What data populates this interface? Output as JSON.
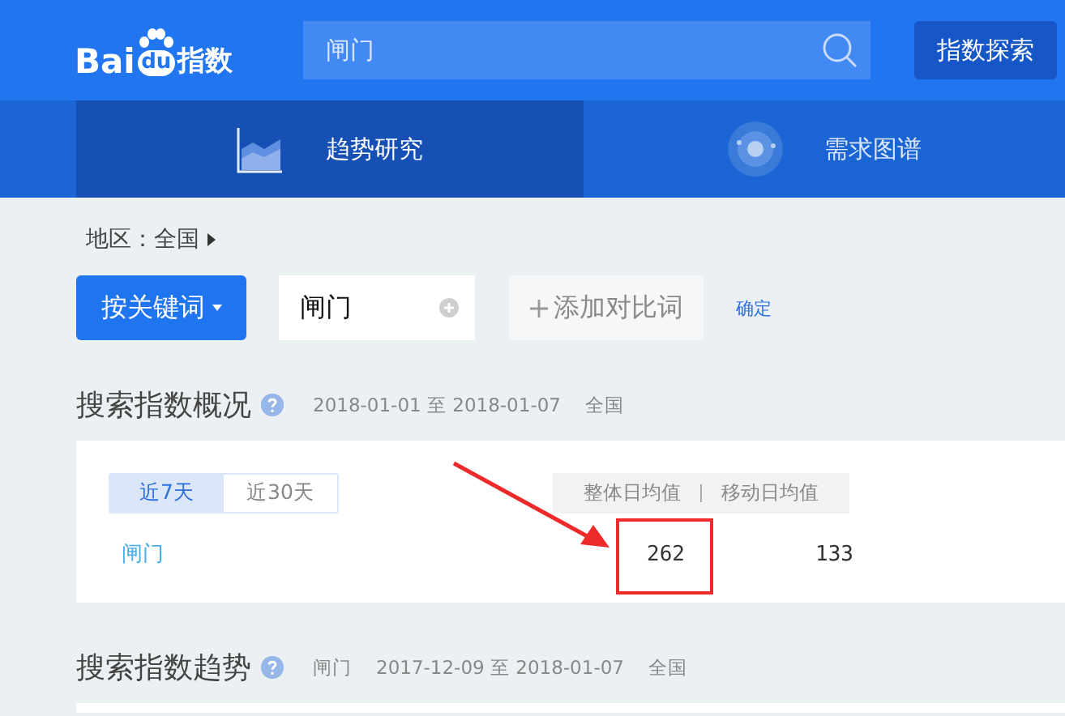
{
  "header": {
    "logo": {
      "part_1": "Bai",
      "part_2": "du",
      "part_3": "指数"
    },
    "search": {
      "value": "闸门"
    },
    "explore_button": "指数探索"
  },
  "nav_tabs": [
    {
      "label": "趋势研究",
      "selected": true,
      "kind": "trend"
    },
    {
      "label": "需求图谱",
      "selected": false,
      "kind": "demand"
    }
  ],
  "region": {
    "label": "地区：全国"
  },
  "toolbar": {
    "mode_button": "按关键词",
    "keyword": "闸门",
    "add_compare": "添加对比词",
    "confirm": "确定"
  },
  "overview": {
    "title": "搜索指数概况",
    "date_range": "2018-01-01 至 2018-01-07",
    "area": "全国",
    "periods": [
      {
        "label": "近7天",
        "selected": true
      },
      {
        "label": "近30天",
        "selected": false
      }
    ],
    "columns": [
      "整体日均值",
      "移动日均值"
    ],
    "rows": [
      {
        "keyword": "闸门",
        "values": [
          "262",
          "133"
        ]
      }
    ],
    "annotation": {
      "highlighted": true
    }
  },
  "trend": {
    "title": "搜索指数趋势",
    "keyword": "闸门",
    "date_range": "2017-12-09 至 2018-01-07",
    "area": "全国"
  }
}
